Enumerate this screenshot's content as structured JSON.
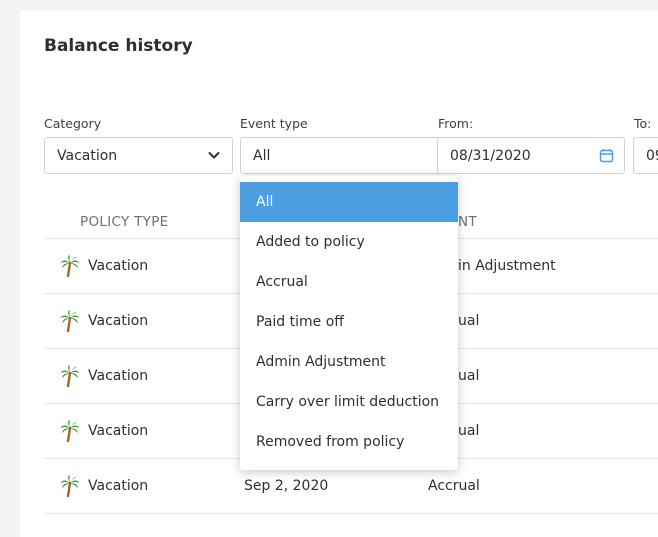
{
  "page": {
    "title": "Balance history"
  },
  "filters": {
    "category": {
      "label": "Category",
      "value": "Vacation"
    },
    "event_type": {
      "label": "Event type",
      "value": "All"
    },
    "from": {
      "label": "From:",
      "value": "08/31/2020"
    },
    "to": {
      "label": "To:",
      "value": "09"
    }
  },
  "table": {
    "headers": [
      "POLICY TYPE",
      "",
      "NT"
    ],
    "rows": [
      {
        "policy": "Vacation",
        "date": "",
        "event": "in Adjustment"
      },
      {
        "policy": "Vacation",
        "date": "",
        "event": "ual"
      },
      {
        "policy": "Vacation",
        "date": "",
        "event": "ual"
      },
      {
        "policy": "Vacation",
        "date": "",
        "event": "ual"
      },
      {
        "policy": "Vacation",
        "date": "Sep 2, 2020",
        "event": "Accrual"
      }
    ]
  },
  "dropdown": {
    "selected_index": 0,
    "options": [
      "All",
      "Added to policy",
      "Accrual",
      "Paid time off",
      "Admin Adjustment",
      "Carry over limit deduction",
      "Removed from policy"
    ]
  },
  "colors": {
    "accent": "#4b9fe1",
    "palm_leaf": "#3f9a2f",
    "palm_trunk": "#a0662a"
  },
  "icons": {
    "policy": "palm-tree-icon",
    "select": "chevron-down-icon",
    "date": "calendar-icon"
  }
}
